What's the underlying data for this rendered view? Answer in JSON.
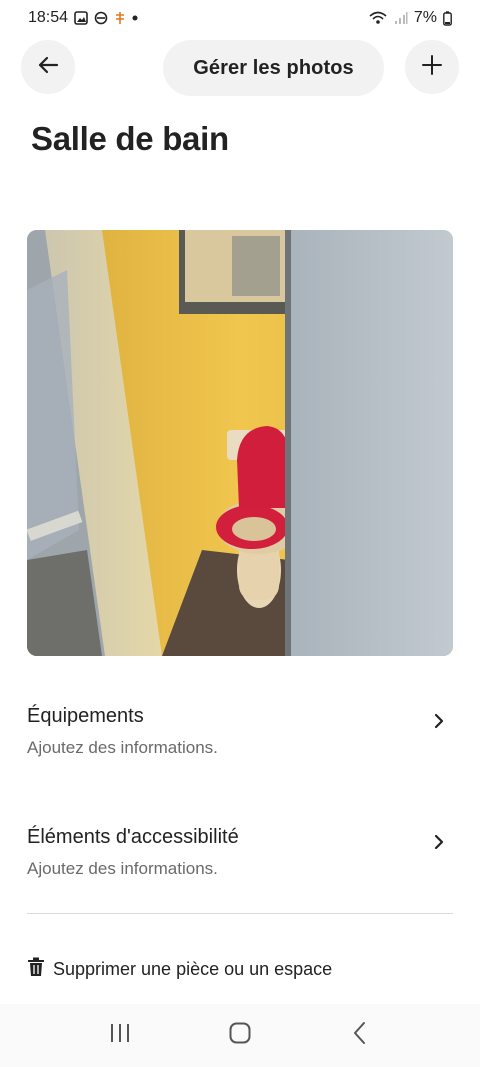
{
  "status_bar": {
    "time": "18:54",
    "battery": "7%"
  },
  "header": {
    "manage_photos_label": "Gérer les photos",
    "back_icon": "arrow-left-icon",
    "add_icon": "plus-icon"
  },
  "page": {
    "title": "Salle de bain"
  },
  "photo": {
    "description_icon": "room-photo"
  },
  "sections": [
    {
      "title": "Équipements",
      "subtitle": "Ajoutez des informations."
    },
    {
      "title": "Éléments d'accessibilité",
      "subtitle": "Ajoutez des informations."
    }
  ],
  "actions": {
    "delete_label": "Supprimer une pièce ou un espace"
  },
  "colors": {
    "text": "#222222",
    "subtext": "#6a6a6a",
    "button_bg": "#f2f2f2",
    "divider": "#dddddd"
  }
}
